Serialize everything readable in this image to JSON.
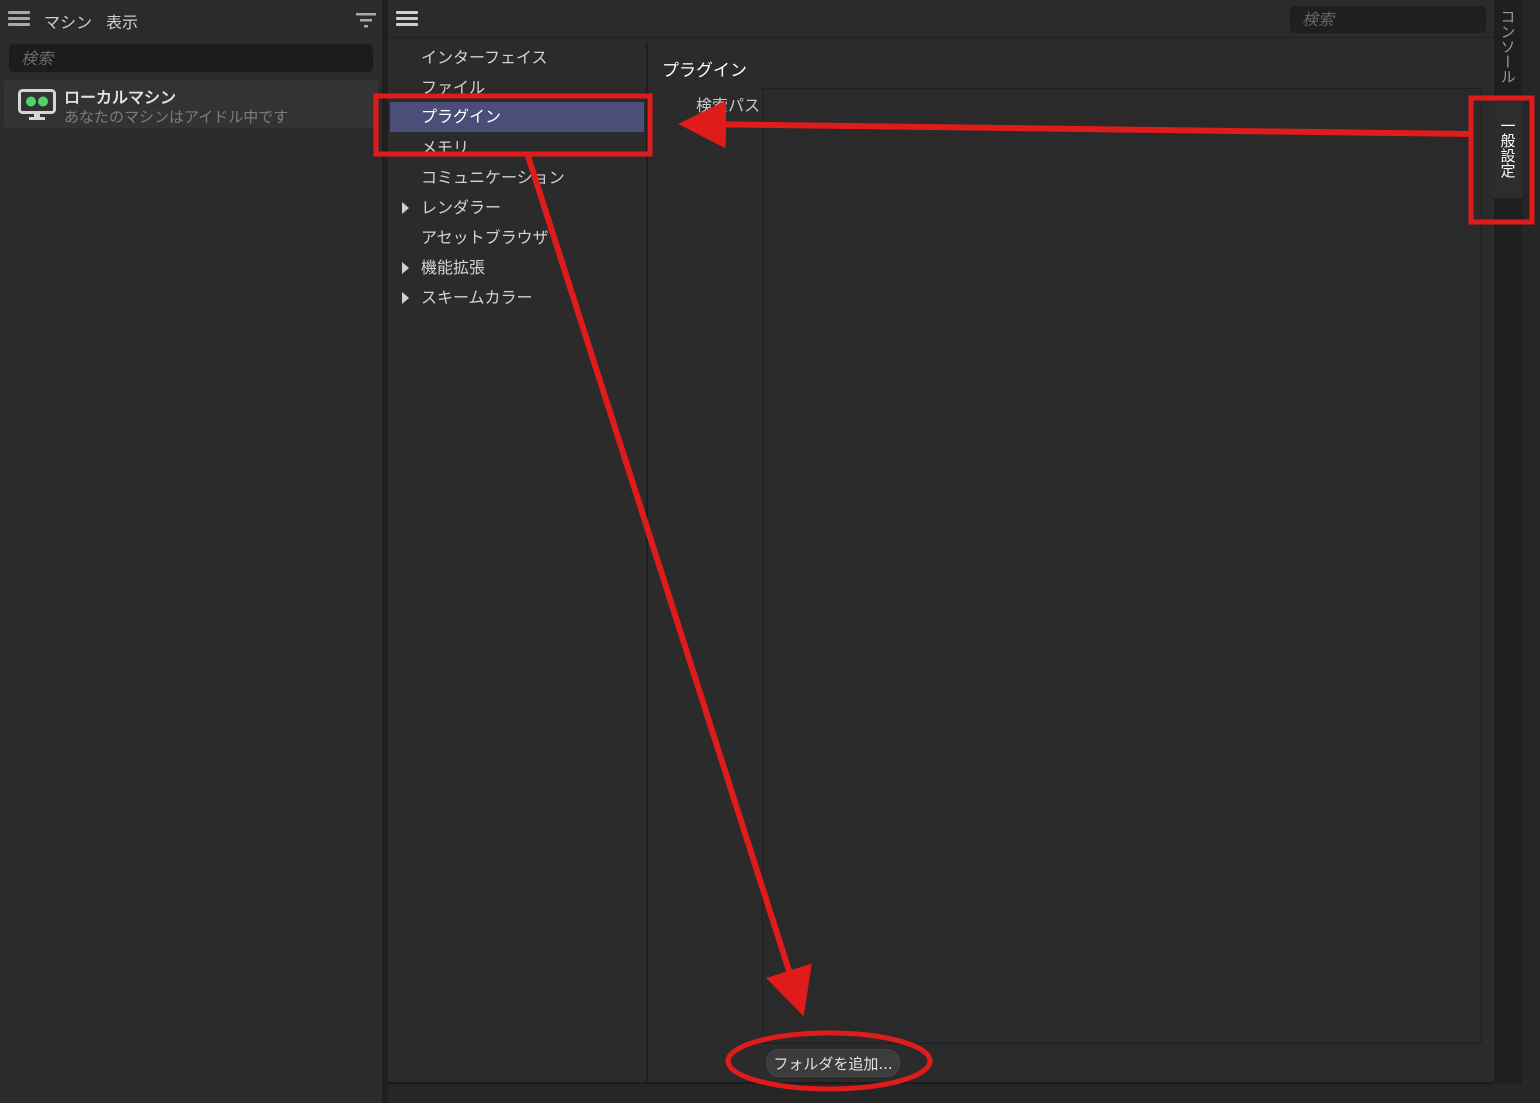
{
  "left_panel": {
    "menu": {
      "machine": "マシン",
      "view": "表示"
    },
    "search": {
      "placeholder": "検索"
    },
    "machine": {
      "name": "ローカルマシン",
      "status": "あなたのマシンはアイドル中です"
    }
  },
  "settings": {
    "search": {
      "placeholder": "検索"
    },
    "categories": [
      {
        "label": "インターフェイス",
        "expandable": false
      },
      {
        "label": "ファイル",
        "expandable": false
      },
      {
        "label": "プラグイン",
        "expandable": false,
        "selected": true
      },
      {
        "label": "メモリ",
        "expandable": false
      },
      {
        "label": "コミュニケーション",
        "expandable": false
      },
      {
        "label": "レンダラー",
        "expandable": true
      },
      {
        "label": "アセットブラウザ",
        "expandable": false
      },
      {
        "label": "機能拡張",
        "expandable": true
      },
      {
        "label": "スキームカラー",
        "expandable": true
      }
    ],
    "section_title": "プラグイン",
    "search_path_label": "検索パス",
    "add_folder_label": "フォルダを追加..."
  },
  "right_tabs": {
    "console": "コンソール",
    "general": "一般設定"
  },
  "colors": {
    "selection": "#4a4f7a",
    "annotation": "#e01b1b",
    "machine_icon_accent": "#4fd36a"
  },
  "icons": [
    "hamburger-icon",
    "filter-icon",
    "monitor-icon",
    "expand-arrow-icon"
  ]
}
